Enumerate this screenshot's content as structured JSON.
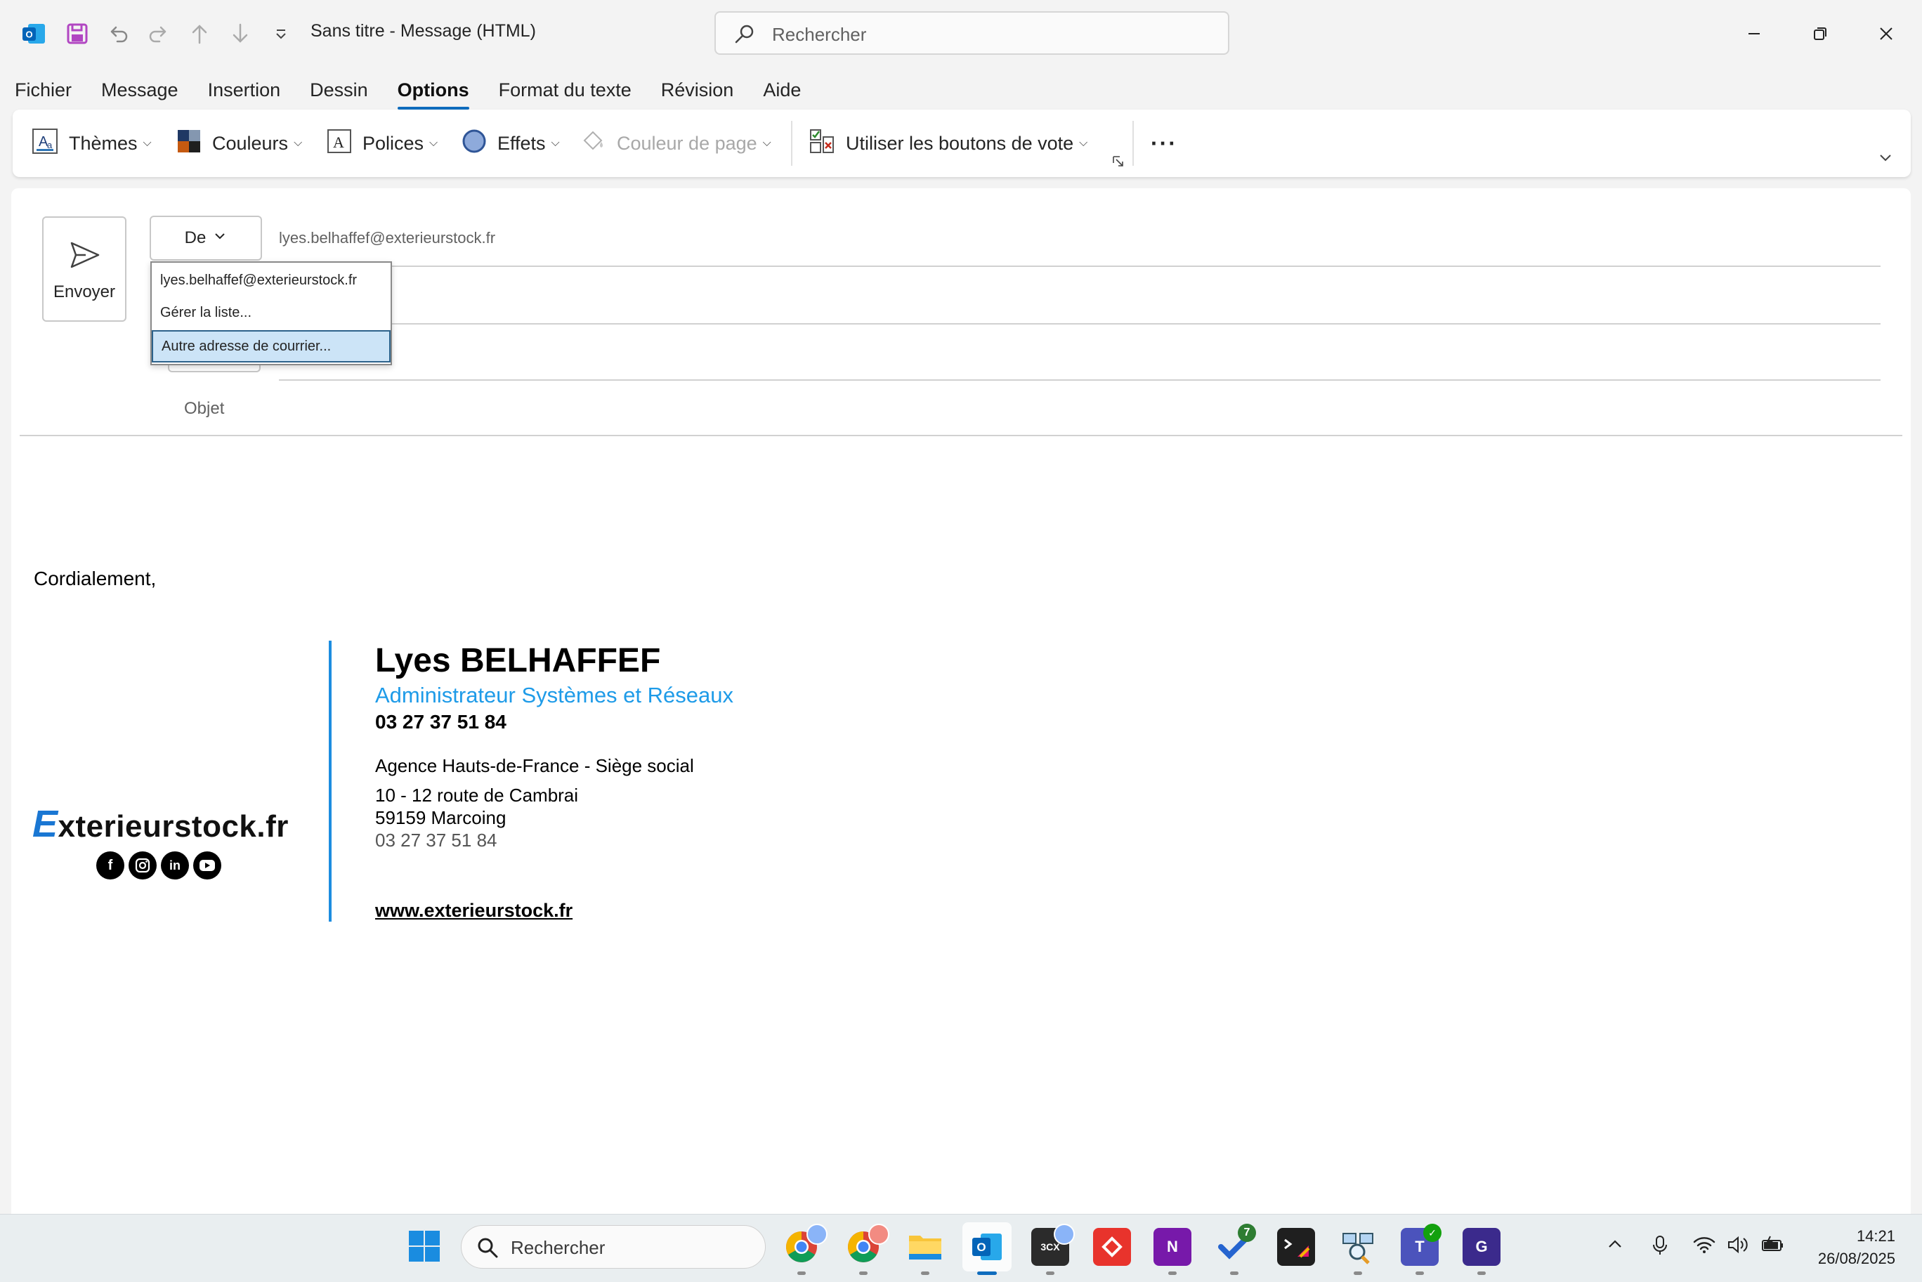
{
  "window": {
    "doc_title": "Sans titre  -  Message (HTML)",
    "search_placeholder": "Rechercher"
  },
  "tabs": [
    {
      "label": "Fichier"
    },
    {
      "label": "Message"
    },
    {
      "label": "Insertion"
    },
    {
      "label": "Dessin"
    },
    {
      "label": "Options",
      "active": true
    },
    {
      "label": "Format du texte"
    },
    {
      "label": "Révision"
    },
    {
      "label": "Aide"
    }
  ],
  "ribbon": {
    "themes": "Thèmes",
    "colors": "Couleurs",
    "fonts": "Polices",
    "effects": "Effets",
    "page_color": "Couleur de page",
    "voting": "Utiliser les boutons de vote",
    "more": "···"
  },
  "compose": {
    "send_label": "Envoyer",
    "from_label": "De",
    "from_value": "lyes.belhaffef@exterieurstock.fr",
    "subject_label": "Objet"
  },
  "from_dropdown": {
    "items": [
      {
        "label": "lyes.belhaffef@exterieurstock.fr",
        "selected": false
      },
      {
        "label": "Gérer la liste...",
        "selected": false
      },
      {
        "label": "Autre adresse de courrier...",
        "selected": true
      }
    ]
  },
  "body": {
    "closing": "Cordialement,",
    "logo_first": "E",
    "logo_rest": "xterieurstock.fr",
    "social": [
      "facebook-icon",
      "instagram-icon",
      "linkedin-icon",
      "youtube-icon"
    ],
    "signature": {
      "name": "Lyes BELHAFFEF",
      "title": "Administrateur Systèmes et Réseaux",
      "phone": "03 27 37 51 84",
      "agency": "Agence Hauts-de-France - Siège social",
      "address1": "10 - 12 route de Cambrai",
      "address2": "59159 Marcoing",
      "phone2": "03 27 37 51 84",
      "website": "www.exterieurstock.fr"
    }
  },
  "taskbar": {
    "search_placeholder": "Rechercher",
    "todo_badge": "7",
    "time": "14:21",
    "date": "26/08/2025"
  },
  "colors": {
    "accent": "#0f6cbd",
    "signature_blue": "#1e9be8",
    "dropdown_selected": "#cce4f7"
  }
}
